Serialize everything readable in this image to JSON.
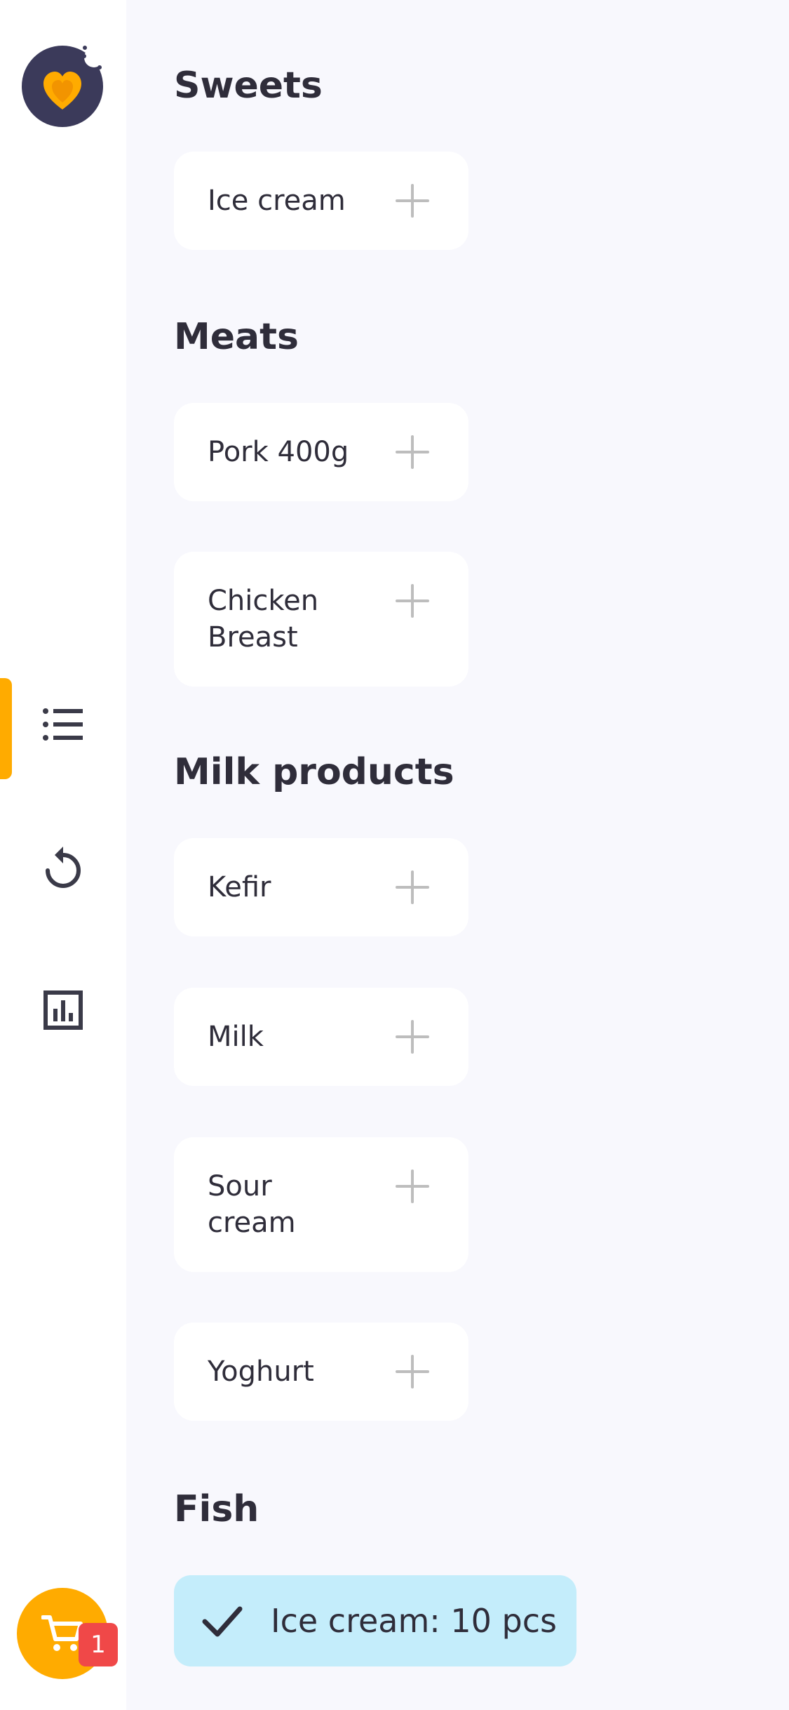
{
  "sidebar": {
    "nav": [
      "list-icon",
      "history-icon",
      "stats-icon"
    ],
    "active_color": "#ffab00",
    "cart_badge": "1"
  },
  "sections": {
    "sweets": {
      "title": "Sweets",
      "items": [
        "Ice cream"
      ]
    },
    "meats": {
      "title": "Meats",
      "items": [
        "Pork 400g",
        "Chicken Breast"
      ]
    },
    "milk": {
      "title": "Milk products",
      "items": [
        "Kefir",
        "Milk",
        "Sour cream",
        "Yoghurt"
      ]
    },
    "fish": {
      "title": "Fish"
    }
  },
  "toast": {
    "text": "Ice cream: 10 pcs",
    "color": "#c4edfb"
  }
}
